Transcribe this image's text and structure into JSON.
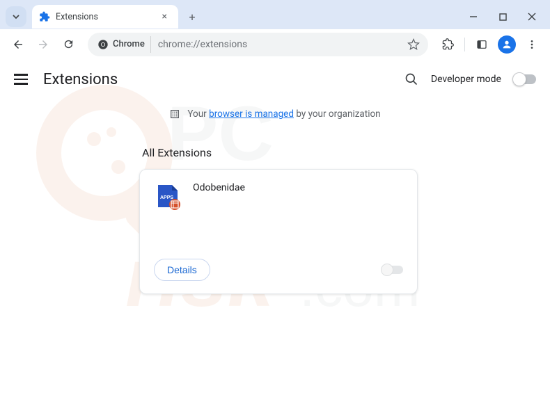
{
  "titlebar": {
    "tab_title": "Extensions"
  },
  "toolbar": {
    "omnibox_chip": "Chrome",
    "omnibox_url": "chrome://extensions"
  },
  "header": {
    "title": "Extensions",
    "devmode_label": "Developer mode"
  },
  "managed": {
    "prefix": "Your",
    "link": "browser is managed",
    "suffix": "by your organization"
  },
  "section": {
    "all_extensions": "All Extensions"
  },
  "extension": {
    "name": "Odobenidae",
    "icon_badge": "APPS",
    "details": "Details"
  }
}
